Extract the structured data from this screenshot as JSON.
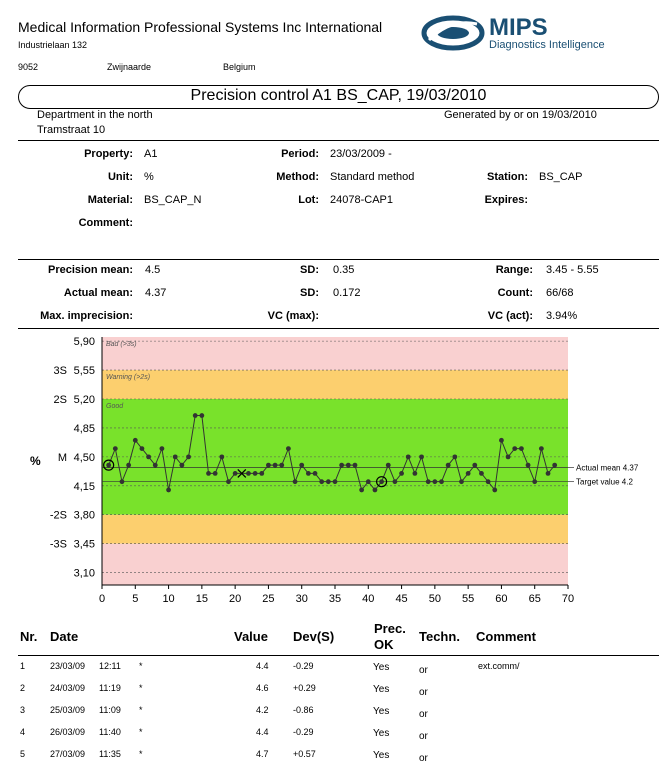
{
  "header": {
    "company": "Medical Information Professional Systems Inc International",
    "street": "Industrielaan 132",
    "postcode": "9052",
    "city": "Zwijnaarde",
    "country": "Belgium",
    "logo_name": "MIPS",
    "logo_tagline": "Diagnostics Intelligence",
    "logo_color": "#1a4f73"
  },
  "title": "Precision control A1 BS_CAP, 19/03/2010",
  "department": "Department in the north",
  "dept_street": "Tramstraat 10",
  "generated": "Generated by or on 19/03/2010",
  "info": {
    "property_label": "Property:",
    "property_value": "A1",
    "period_label": "Period:",
    "period_value": "23/03/2009 -",
    "unit_label": "Unit:",
    "unit_value": "%",
    "method_label": "Method:",
    "method_value": "Standard method",
    "station_label": "Station:",
    "station_value": "BS_CAP",
    "material_label": "Material:",
    "material_value": "BS_CAP_N",
    "lot_label": "Lot:",
    "lot_value": "24078-CAP1",
    "expires_label": "Expires:",
    "comment_label": "Comment:"
  },
  "stats": {
    "precision_mean_label": "Precision mean:",
    "precision_mean_value": "4.5",
    "sd1_label": "SD:",
    "sd1_value": "0.35",
    "range_label": "Range:",
    "range_value": "3.45 - 5.55",
    "actual_mean_label": "Actual mean:",
    "actual_mean_value": "4.37",
    "sd2_label": "SD:",
    "sd2_value": "0.172",
    "count_label": "Count:",
    "count_value": "66/68",
    "max_imprecision_label": "Max. imprecision:",
    "vc_max_label": "VC (max):",
    "vc_act_label": "VC (act):",
    "vc_act_value": "3.94%"
  },
  "chart_data": {
    "type": "line",
    "unit_label": "%",
    "y_ticks": [
      {
        "label": "5,90",
        "sd": "",
        "value": 5.9
      },
      {
        "label": "5,55",
        "sd": "3S",
        "value": 5.55
      },
      {
        "label": "5,20",
        "sd": "2S",
        "value": 5.2
      },
      {
        "label": "4,85",
        "sd": "",
        "value": 4.85
      },
      {
        "label": "4,50",
        "sd": "M",
        "value": 4.5
      },
      {
        "label": "4,15",
        "sd": "",
        "value": 4.15
      },
      {
        "label": "3,80",
        "sd": "-2S",
        "value": 3.8
      },
      {
        "label": "3,45",
        "sd": "-3S",
        "value": 3.45
      },
      {
        "label": "3,10",
        "sd": "",
        "value": 3.1
      }
    ],
    "x_ticks": [
      0,
      5,
      10,
      15,
      20,
      25,
      30,
      35,
      40,
      45,
      50,
      55,
      60,
      65,
      70
    ],
    "xlim": [
      0,
      70
    ],
    "ylim": [
      2.95,
      5.95
    ],
    "zones": [
      {
        "from": 5.55,
        "to": 5.95,
        "color": "#f9d0d0",
        "label": "Bad (>3s)"
      },
      {
        "from": 5.2,
        "to": 5.55,
        "color": "#fccf6e",
        "label": "Warning (>2s)"
      },
      {
        "from": 3.8,
        "to": 5.2,
        "color": "#79e22b",
        "label": "Good"
      },
      {
        "from": 3.45,
        "to": 3.8,
        "color": "#fccf6e",
        "label": ""
      },
      {
        "from": 2.95,
        "to": 3.45,
        "color": "#f9d0d0",
        "label": ""
      }
    ],
    "actual_mean": 4.37,
    "actual_mean_label": "Actual mean 4.37",
    "target": 4.2,
    "target_label": "Target value 4.2",
    "values": [
      4.4,
      4.6,
      4.2,
      4.4,
      4.7,
      4.6,
      4.5,
      4.4,
      4.6,
      4.1,
      4.5,
      4.4,
      4.5,
      5.0,
      5.0,
      4.3,
      4.3,
      4.5,
      4.2,
      4.3,
      4.3,
      4.3,
      4.3,
      4.3,
      4.4,
      4.4,
      4.4,
      4.6,
      4.2,
      4.4,
      4.3,
      4.3,
      4.2,
      4.2,
      4.2,
      4.4,
      4.4,
      4.4,
      4.1,
      4.2,
      4.1,
      4.2,
      4.4,
      4.2,
      4.3,
      4.5,
      4.3,
      4.5,
      4.2,
      4.2,
      4.2,
      4.4,
      4.5,
      4.2,
      4.3,
      4.4,
      4.3,
      4.2,
      4.1,
      4.7,
      4.5,
      4.6,
      4.6,
      4.4,
      4.2,
      4.6,
      4.3,
      4.4
    ],
    "circled_points": [
      1,
      42
    ],
    "crossed_points": [
      21
    ]
  },
  "table": {
    "headers": {
      "nr": "Nr.",
      "date": "Date",
      "value": "Value",
      "dev": "Dev(S)",
      "prec1": "Prec.",
      "prec2": "OK",
      "techn": "Techn.",
      "comment": "Comment"
    },
    "rows": [
      {
        "nr": "1",
        "date": "23/03/09",
        "time": "12:11",
        "star": "*",
        "value": "4.4",
        "dev": "-0.29",
        "prec": "Yes",
        "techn": "or",
        "comment": "ext.comm/"
      },
      {
        "nr": "2",
        "date": "24/03/09",
        "time": "11:19",
        "star": "*",
        "value": "4.6",
        "dev": "+0.29",
        "prec": "Yes",
        "techn": "or",
        "comment": ""
      },
      {
        "nr": "3",
        "date": "25/03/09",
        "time": "11:09",
        "star": "*",
        "value": "4.2",
        "dev": "-0.86",
        "prec": "Yes",
        "techn": "or",
        "comment": ""
      },
      {
        "nr": "4",
        "date": "26/03/09",
        "time": "11:40",
        "star": "*",
        "value": "4.4",
        "dev": "-0.29",
        "prec": "Yes",
        "techn": "or",
        "comment": ""
      },
      {
        "nr": "5",
        "date": "27/03/09",
        "time": "11:35",
        "star": "*",
        "value": "4.7",
        "dev": "+0.57",
        "prec": "Yes",
        "techn": "or",
        "comment": ""
      }
    ]
  }
}
